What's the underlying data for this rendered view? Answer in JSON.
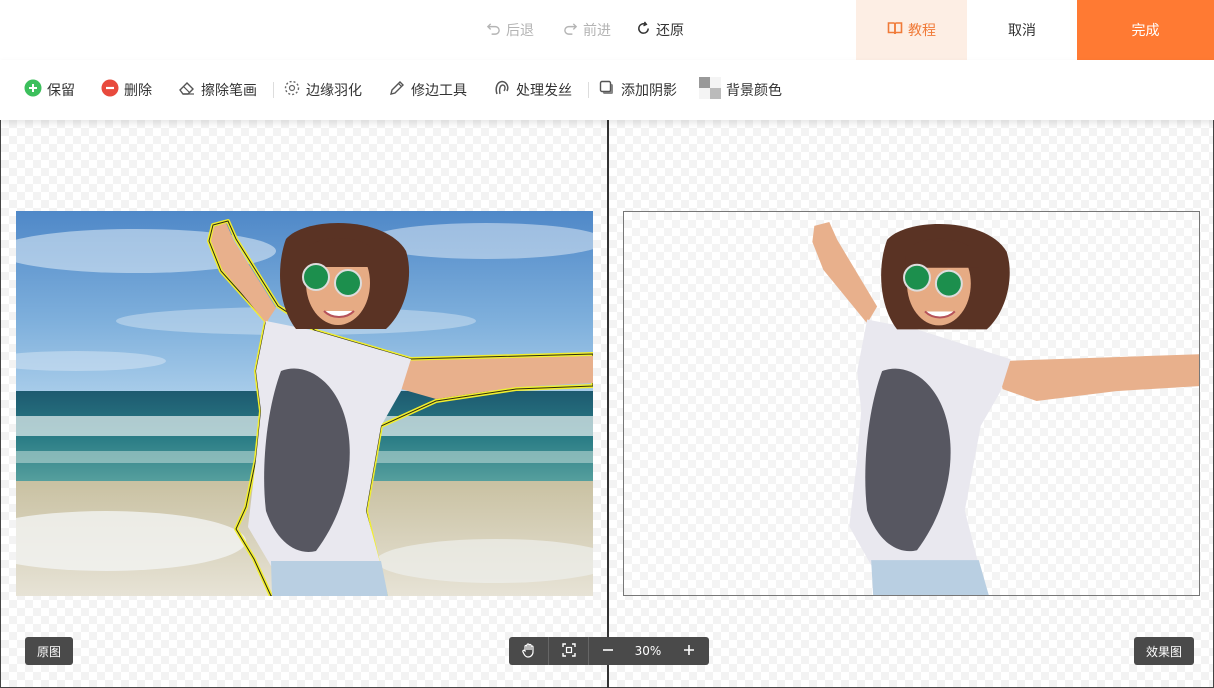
{
  "topbar": {
    "undo_label": "后退",
    "redo_label": "前进",
    "restore_label": "还原",
    "tutorial_label": "教程",
    "cancel_label": "取消",
    "done_label": "完成"
  },
  "toolbar": {
    "keep_label": "保留",
    "delete_label": "删除",
    "eraser_label": "擦除笔画",
    "feather_label": "边缘羽化",
    "trim_label": "修边工具",
    "hair_label": "处理发丝",
    "shadow_label": "添加阴影",
    "bgcolor_label": "背景颜色"
  },
  "canvas": {
    "original_label": "原图",
    "result_label": "效果图",
    "zoom": "30%"
  },
  "colors": {
    "accent": "#ff7a33",
    "tutorial_bg": "#fdeee4",
    "keep_green": "#3cbf5c",
    "delete_red": "#e84a3d",
    "outline_yellow": "#f2ef2e"
  }
}
